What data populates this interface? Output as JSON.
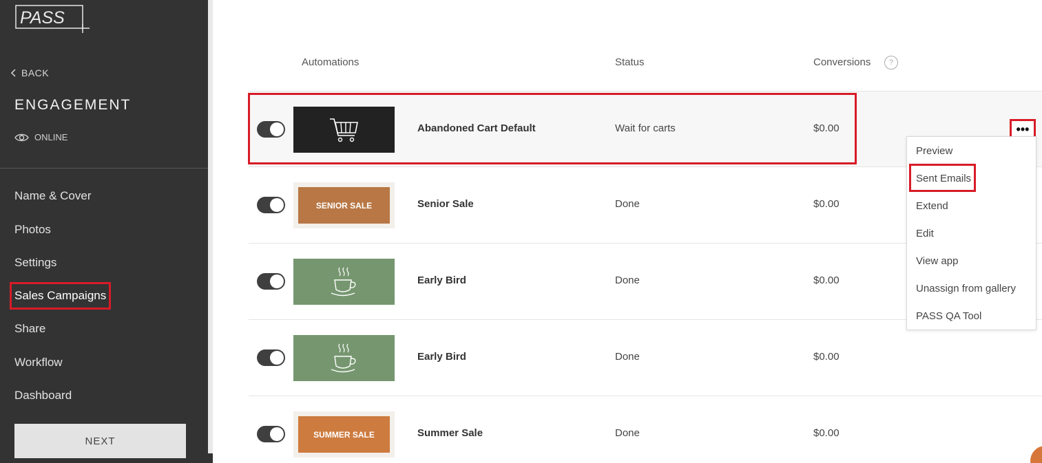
{
  "sidebar": {
    "logo_text": "PASS",
    "back_label": "BACK",
    "section_title": "ENGAGEMENT",
    "status_label": "ONLINE",
    "nav": [
      {
        "label": "Name & Cover"
      },
      {
        "label": "Photos"
      },
      {
        "label": "Settings"
      },
      {
        "label": "Sales Campaigns"
      },
      {
        "label": "Share"
      },
      {
        "label": "Workflow"
      },
      {
        "label": "Dashboard"
      }
    ],
    "active_nav": "Sales Campaigns",
    "next_label": "NEXT"
  },
  "table": {
    "headers": {
      "automations": "Automations",
      "status": "Status",
      "conversions": "Conversions",
      "help": "?"
    },
    "rows": [
      {
        "name": "Abandoned Cart Default",
        "status": "Wait for carts",
        "conversions": "$0.00",
        "thumb": "cart-icon",
        "enabled": true
      },
      {
        "name": "Senior Sale",
        "status": "Done",
        "conversions": "$0.00",
        "thumb_text": "SENIOR SALE",
        "enabled": true
      },
      {
        "name": "Early Bird",
        "status": "Done",
        "conversions": "$0.00",
        "thumb": "coffee-cup-icon",
        "enabled": true
      },
      {
        "name": "Early Bird",
        "status": "Done",
        "conversions": "$0.00",
        "thumb": "coffee-cup-icon",
        "enabled": true
      },
      {
        "name": "Summer Sale",
        "status": "Done",
        "conversions": "$0.00",
        "thumb_text": "SUMMER SALE",
        "enabled": true
      }
    ]
  },
  "menu": {
    "more_label": "•••",
    "items": [
      {
        "label": "Preview"
      },
      {
        "label": "Sent Emails"
      },
      {
        "label": "Extend"
      },
      {
        "label": "Edit"
      },
      {
        "label": "View app"
      },
      {
        "label": "Unassign from gallery"
      },
      {
        "label": "PASS QA Tool"
      }
    ]
  },
  "colors": {
    "sidebar_bg": "#333333",
    "highlight": "#d81b27",
    "senior_sale": "#b87745",
    "summer_sale": "#cd7b3f",
    "early_bird": "#769670"
  }
}
